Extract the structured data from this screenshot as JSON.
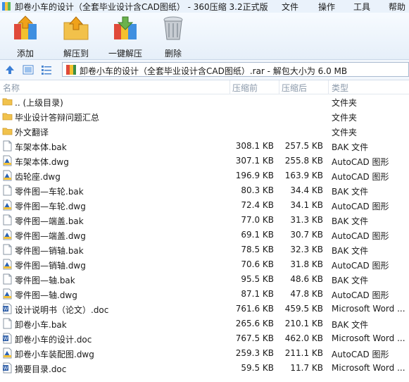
{
  "window": {
    "title": "卸卷小车的设计（全套毕业设计含CAD图纸） - 360压缩 3.2正式版",
    "menu": [
      "文件",
      "操作",
      "工具",
      "帮助"
    ]
  },
  "toolbar": {
    "buttons": [
      {
        "label": "添加",
        "icon": "add-archive-icon"
      },
      {
        "label": "解压到",
        "icon": "extract-to-icon"
      },
      {
        "label": "一键解压",
        "icon": "one-click-extract-icon"
      },
      {
        "label": "删除",
        "icon": "trash-icon"
      }
    ]
  },
  "addressbar": {
    "path": "卸卷小车的设计（全套毕业设计含CAD图纸）.rar - 解包大小为 6.0 MB"
  },
  "columns": {
    "name": "名称",
    "size": "压缩前",
    "packed": "压缩后",
    "type": "类型"
  },
  "files": [
    {
      "name": ".. (上级目录)",
      "size": "",
      "packed": "",
      "type": "文件夹",
      "icon": "folder"
    },
    {
      "name": "毕业设计答辩问题汇总",
      "size": "",
      "packed": "",
      "type": "文件夹",
      "icon": "folder"
    },
    {
      "name": "外文翻译",
      "size": "",
      "packed": "",
      "type": "文件夹",
      "icon": "folder"
    },
    {
      "name": "车架本体.bak",
      "size": "308.1 KB",
      "packed": "257.5 KB",
      "type": "BAK 文件",
      "icon": "file"
    },
    {
      "name": "车架本体.dwg",
      "size": "307.1 KB",
      "packed": "255.8 KB",
      "type": "AutoCAD 图形",
      "icon": "dwg"
    },
    {
      "name": "齿轮座.dwg",
      "size": "196.9 KB",
      "packed": "163.9 KB",
      "type": "AutoCAD 图形",
      "icon": "dwg"
    },
    {
      "name": "零件图—车轮.bak",
      "size": "80.3 KB",
      "packed": "34.4 KB",
      "type": "BAK 文件",
      "icon": "file"
    },
    {
      "name": "零件图—车轮.dwg",
      "size": "72.4 KB",
      "packed": "34.1 KB",
      "type": "AutoCAD 图形",
      "icon": "dwg"
    },
    {
      "name": "零件图—端盖.bak",
      "size": "77.0 KB",
      "packed": "31.3 KB",
      "type": "BAK 文件",
      "icon": "file"
    },
    {
      "name": "零件图—端盖.dwg",
      "size": "69.1 KB",
      "packed": "30.7 KB",
      "type": "AutoCAD 图形",
      "icon": "dwg"
    },
    {
      "name": "零件图—销轴.bak",
      "size": "78.5 KB",
      "packed": "32.3 KB",
      "type": "BAK 文件",
      "icon": "file"
    },
    {
      "name": "零件图—销轴.dwg",
      "size": "70.6 KB",
      "packed": "31.8 KB",
      "type": "AutoCAD 图形",
      "icon": "dwg"
    },
    {
      "name": "零件图—轴.bak",
      "size": "95.5 KB",
      "packed": "48.6 KB",
      "type": "BAK 文件",
      "icon": "file"
    },
    {
      "name": "零件图—轴.dwg",
      "size": "87.1 KB",
      "packed": "47.8 KB",
      "type": "AutoCAD 图形",
      "icon": "dwg"
    },
    {
      "name": "设计说明书（论文）.doc",
      "size": "761.6 KB",
      "packed": "459.5 KB",
      "type": "Microsoft Word ...",
      "icon": "doc"
    },
    {
      "name": "卸卷小车.bak",
      "size": "265.6 KB",
      "packed": "210.1 KB",
      "type": "BAK 文件",
      "icon": "file"
    },
    {
      "name": "卸卷小车的设计.doc",
      "size": "767.5 KB",
      "packed": "462.0 KB",
      "type": "Microsoft Word ...",
      "icon": "doc"
    },
    {
      "name": "卸卷小车装配图.dwg",
      "size": "259.3 KB",
      "packed": "211.1 KB",
      "type": "AutoCAD 图形",
      "icon": "dwg"
    },
    {
      "name": "摘要目录.doc",
      "size": "59.5 KB",
      "packed": "11.7 KB",
      "type": "Microsoft Word ...",
      "icon": "doc"
    }
  ],
  "colors": {
    "titlebar": "#eaf2fb",
    "header_text": "#8c9aab",
    "folder": "#f1c24c",
    "dwg_blue": "#2b63b5",
    "doc_blue": "#2f5fa8"
  }
}
